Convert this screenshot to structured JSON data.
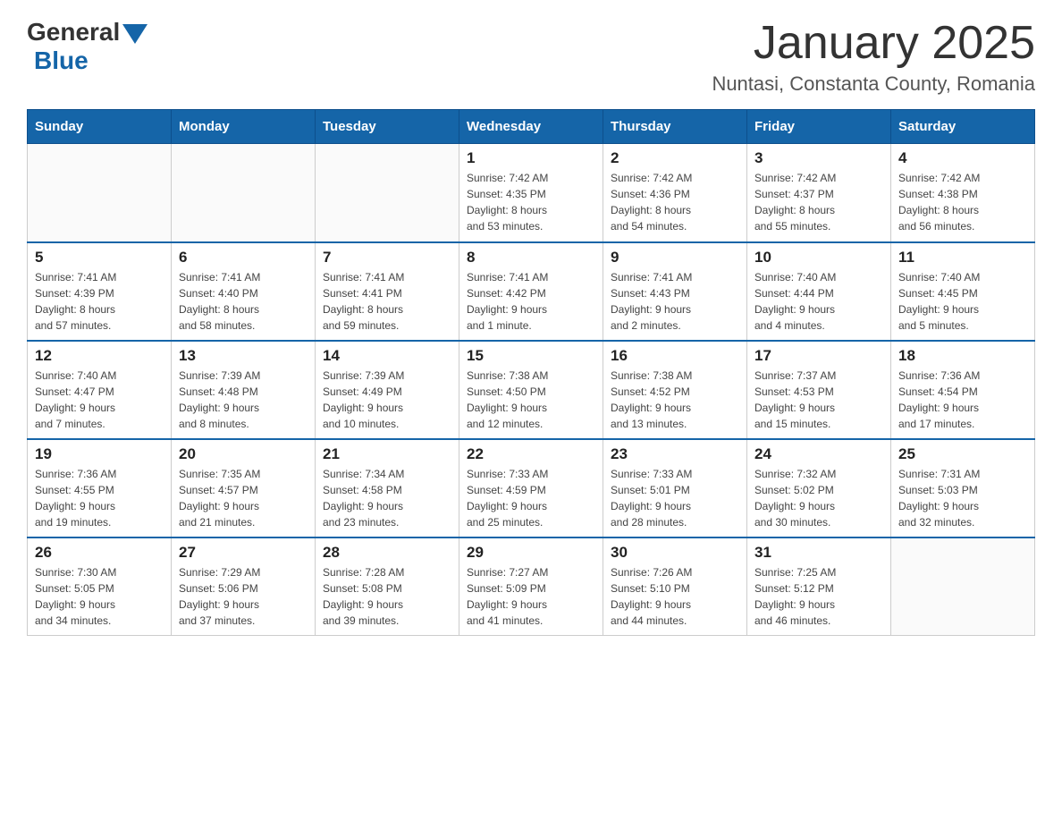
{
  "header": {
    "logo": {
      "general": "General",
      "blue": "Blue"
    },
    "title": "January 2025",
    "location": "Nuntasi, Constanta County, Romania"
  },
  "weekdays": [
    "Sunday",
    "Monday",
    "Tuesday",
    "Wednesday",
    "Thursday",
    "Friday",
    "Saturday"
  ],
  "weeks": [
    [
      {
        "day": "",
        "info": ""
      },
      {
        "day": "",
        "info": ""
      },
      {
        "day": "",
        "info": ""
      },
      {
        "day": "1",
        "info": "Sunrise: 7:42 AM\nSunset: 4:35 PM\nDaylight: 8 hours\nand 53 minutes."
      },
      {
        "day": "2",
        "info": "Sunrise: 7:42 AM\nSunset: 4:36 PM\nDaylight: 8 hours\nand 54 minutes."
      },
      {
        "day": "3",
        "info": "Sunrise: 7:42 AM\nSunset: 4:37 PM\nDaylight: 8 hours\nand 55 minutes."
      },
      {
        "day": "4",
        "info": "Sunrise: 7:42 AM\nSunset: 4:38 PM\nDaylight: 8 hours\nand 56 minutes."
      }
    ],
    [
      {
        "day": "5",
        "info": "Sunrise: 7:41 AM\nSunset: 4:39 PM\nDaylight: 8 hours\nand 57 minutes."
      },
      {
        "day": "6",
        "info": "Sunrise: 7:41 AM\nSunset: 4:40 PM\nDaylight: 8 hours\nand 58 minutes."
      },
      {
        "day": "7",
        "info": "Sunrise: 7:41 AM\nSunset: 4:41 PM\nDaylight: 8 hours\nand 59 minutes."
      },
      {
        "day": "8",
        "info": "Sunrise: 7:41 AM\nSunset: 4:42 PM\nDaylight: 9 hours\nand 1 minute."
      },
      {
        "day": "9",
        "info": "Sunrise: 7:41 AM\nSunset: 4:43 PM\nDaylight: 9 hours\nand 2 minutes."
      },
      {
        "day": "10",
        "info": "Sunrise: 7:40 AM\nSunset: 4:44 PM\nDaylight: 9 hours\nand 4 minutes."
      },
      {
        "day": "11",
        "info": "Sunrise: 7:40 AM\nSunset: 4:45 PM\nDaylight: 9 hours\nand 5 minutes."
      }
    ],
    [
      {
        "day": "12",
        "info": "Sunrise: 7:40 AM\nSunset: 4:47 PM\nDaylight: 9 hours\nand 7 minutes."
      },
      {
        "day": "13",
        "info": "Sunrise: 7:39 AM\nSunset: 4:48 PM\nDaylight: 9 hours\nand 8 minutes."
      },
      {
        "day": "14",
        "info": "Sunrise: 7:39 AM\nSunset: 4:49 PM\nDaylight: 9 hours\nand 10 minutes."
      },
      {
        "day": "15",
        "info": "Sunrise: 7:38 AM\nSunset: 4:50 PM\nDaylight: 9 hours\nand 12 minutes."
      },
      {
        "day": "16",
        "info": "Sunrise: 7:38 AM\nSunset: 4:52 PM\nDaylight: 9 hours\nand 13 minutes."
      },
      {
        "day": "17",
        "info": "Sunrise: 7:37 AM\nSunset: 4:53 PM\nDaylight: 9 hours\nand 15 minutes."
      },
      {
        "day": "18",
        "info": "Sunrise: 7:36 AM\nSunset: 4:54 PM\nDaylight: 9 hours\nand 17 minutes."
      }
    ],
    [
      {
        "day": "19",
        "info": "Sunrise: 7:36 AM\nSunset: 4:55 PM\nDaylight: 9 hours\nand 19 minutes."
      },
      {
        "day": "20",
        "info": "Sunrise: 7:35 AM\nSunset: 4:57 PM\nDaylight: 9 hours\nand 21 minutes."
      },
      {
        "day": "21",
        "info": "Sunrise: 7:34 AM\nSunset: 4:58 PM\nDaylight: 9 hours\nand 23 minutes."
      },
      {
        "day": "22",
        "info": "Sunrise: 7:33 AM\nSunset: 4:59 PM\nDaylight: 9 hours\nand 25 minutes."
      },
      {
        "day": "23",
        "info": "Sunrise: 7:33 AM\nSunset: 5:01 PM\nDaylight: 9 hours\nand 28 minutes."
      },
      {
        "day": "24",
        "info": "Sunrise: 7:32 AM\nSunset: 5:02 PM\nDaylight: 9 hours\nand 30 minutes."
      },
      {
        "day": "25",
        "info": "Sunrise: 7:31 AM\nSunset: 5:03 PM\nDaylight: 9 hours\nand 32 minutes."
      }
    ],
    [
      {
        "day": "26",
        "info": "Sunrise: 7:30 AM\nSunset: 5:05 PM\nDaylight: 9 hours\nand 34 minutes."
      },
      {
        "day": "27",
        "info": "Sunrise: 7:29 AM\nSunset: 5:06 PM\nDaylight: 9 hours\nand 37 minutes."
      },
      {
        "day": "28",
        "info": "Sunrise: 7:28 AM\nSunset: 5:08 PM\nDaylight: 9 hours\nand 39 minutes."
      },
      {
        "day": "29",
        "info": "Sunrise: 7:27 AM\nSunset: 5:09 PM\nDaylight: 9 hours\nand 41 minutes."
      },
      {
        "day": "30",
        "info": "Sunrise: 7:26 AM\nSunset: 5:10 PM\nDaylight: 9 hours\nand 44 minutes."
      },
      {
        "day": "31",
        "info": "Sunrise: 7:25 AM\nSunset: 5:12 PM\nDaylight: 9 hours\nand 46 minutes."
      },
      {
        "day": "",
        "info": ""
      }
    ]
  ]
}
